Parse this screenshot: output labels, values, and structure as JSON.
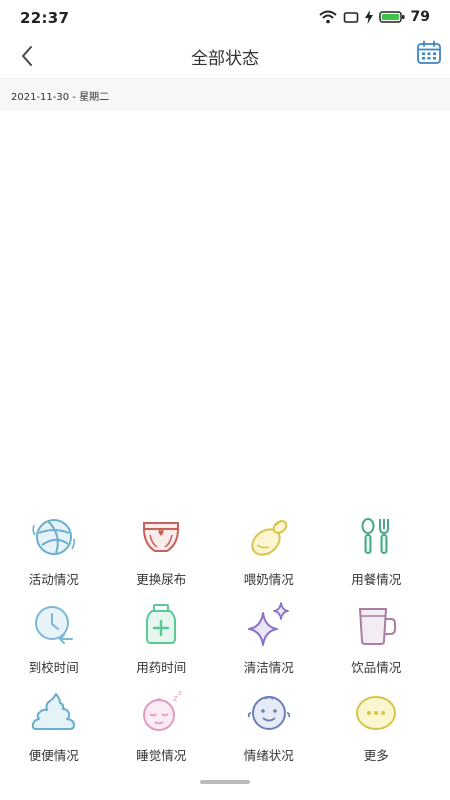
{
  "status": {
    "time": "22:37",
    "battery": "79"
  },
  "nav": {
    "title": "全部状态"
  },
  "date": "2021-11-30 - 星期二",
  "grid": {
    "items": [
      {
        "label": "活动情况",
        "icon": "ball-icon"
      },
      {
        "label": "更换尿布",
        "icon": "diaper-icon"
      },
      {
        "label": "喂奶情况",
        "icon": "baby-bottle-icon"
      },
      {
        "label": "用餐情况",
        "icon": "spoon-fork-icon"
      },
      {
        "label": "到校时间",
        "icon": "clock-icon"
      },
      {
        "label": "用药时间",
        "icon": "medicine-bottle-icon"
      },
      {
        "label": "清洁情况",
        "icon": "sparkle-icon"
      },
      {
        "label": "饮品情况",
        "icon": "cup-icon"
      },
      {
        "label": "便便情况",
        "icon": "poop-icon"
      },
      {
        "label": "睡觉情况",
        "icon": "sleeping-baby-icon"
      },
      {
        "label": "情绪状况",
        "icon": "baby-face-icon"
      },
      {
        "label": "更多",
        "icon": "more-icon"
      }
    ]
  },
  "colors": {
    "blue": "#6aaecc",
    "red": "#c7625a",
    "yellow": "#e6d24f",
    "green": "#4aa886",
    "lightblue": "#7cb8d6",
    "mint": "#5cc89a",
    "purple": "#8a71c9",
    "mauve": "#a87ea2",
    "pink": "#e39ac3",
    "navy": "#6b80b8",
    "olive": "#d6c54a",
    "accent": "#3a86c8"
  }
}
